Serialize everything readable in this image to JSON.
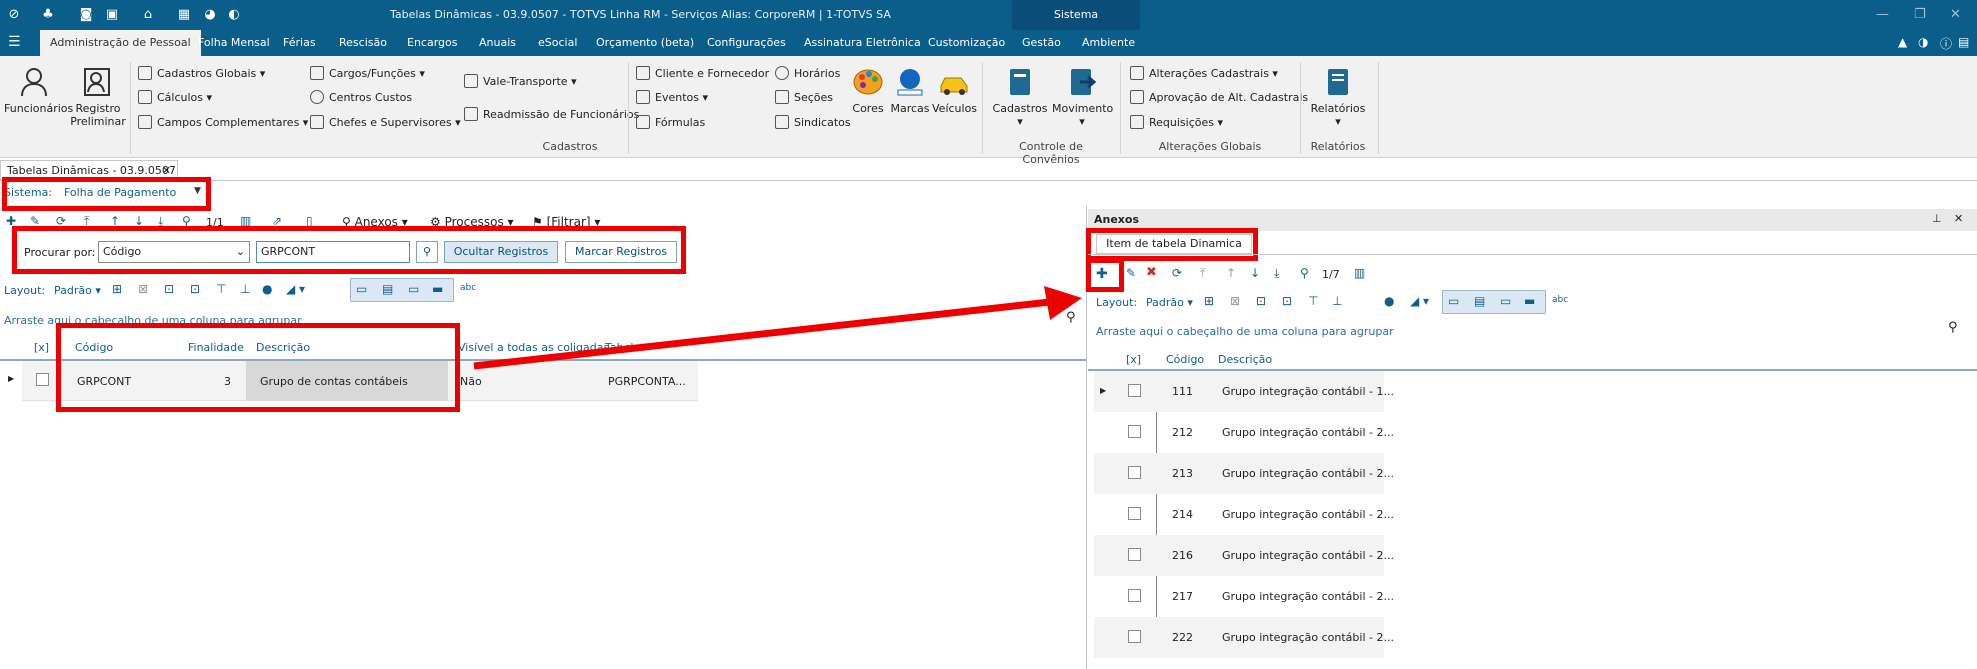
{
  "window": {
    "title": "Tabelas Dinâmicas - 03.9.0507 - TOTVS Linha RM - Serviços  Alias: CorporeRM | 1-TOTVS SA",
    "system": "Sistema"
  },
  "menu": [
    "Administração de Pessoal",
    "Folha Mensal",
    "Férias",
    "Rescisão",
    "Encargos",
    "Anuais",
    "eSocial",
    "Orçamento (beta)",
    "Configurações",
    "Assinatura Eletrônica",
    "Customização",
    "Gestão",
    "Ambiente"
  ],
  "ribbon": {
    "funcionarios": "Funcionários",
    "registro1": "Registro",
    "registro2": "Preliminar",
    "cadastros_globais": "Cadastros Globais",
    "calculos": "Cálculos",
    "campos_complementares": "Campos Complementares",
    "cargos": "Cargos/Funções",
    "centros_custos": "Centros Custos",
    "chefes": "Chefes e Supervisores",
    "vale_transporte": "Vale-Transporte",
    "readmissao": "Readmissão de Funcionários",
    "cliente_fornecedor": "Cliente e Fornecedor",
    "eventos": "Eventos",
    "formulas": "Fórmulas",
    "horarios": "Horários",
    "secoes": "Seções",
    "sindicatos": "Sindicatos",
    "cores": "Cores",
    "marcas": "Marcas",
    "veiculos": "Veículos",
    "cadastros_btn": "Cadastros",
    "movimento": "Movimento",
    "alteracoes_cadastrais": "Alterações Cadastrais",
    "aprovacao": "Aprovação de Alt. Cadastrais",
    "requisicoes": "Requisições",
    "relatorios": "Relatórios",
    "grp_cadastros": "Cadastros",
    "grp_convenios": "Controle de Convênios",
    "grp_alteracoes": "Alterações Globais",
    "grp_relatorios": "Relatórios"
  },
  "doc_tab": "Tabelas Dinâmicas - 03.9.0507",
  "left": {
    "sistema_label": "Sistema:",
    "sistema_value": "Folha de Pagamento",
    "page_counter": "1/1",
    "anexos": "Anexos",
    "processos": "Processos",
    "filtrar": "[Filtrar]",
    "procurar_label": "Procurar por:",
    "procurar_campo": "Código",
    "procurar_valor": "GRPCONT",
    "ocultar": "Ocultar Registros",
    "marcar": "Marcar Registros",
    "layout_label": "Layout:",
    "layout_value": "Padrão",
    "group_hint": "Arraste aqui o cabeçalho de uma coluna para agrupar",
    "columns": [
      "[x]",
      "Código",
      "Finalidade",
      "Descrição",
      "Visível a todas as coligadas",
      "Tabela"
    ],
    "rows": [
      {
        "codigo": "GRPCONT",
        "finalidade": "3",
        "descricao": "Grupo de contas contábeis",
        "visivel": "Não",
        "tabela": "PGRPCONTA..."
      }
    ]
  },
  "right": {
    "title": "Anexos",
    "tab": "Item de tabela Dinamica",
    "page_counter": "1/7",
    "layout_label": "Layout:",
    "layout_value": "Padrão",
    "group_hint": "Arraste aqui o cabeçalho de uma coluna para agrupar",
    "columns": [
      "[x]",
      "Código",
      "Descrição"
    ],
    "rows": [
      {
        "codigo": "111",
        "descricao": "Grupo integração contábil - 1..."
      },
      {
        "codigo": "212",
        "descricao": "Grupo integração contábil - 2..."
      },
      {
        "codigo": "213",
        "descricao": "Grupo integração contábil - 2..."
      },
      {
        "codigo": "214",
        "descricao": "Grupo integração contábil - 2..."
      },
      {
        "codigo": "216",
        "descricao": "Grupo integração contábil - 2..."
      },
      {
        "codigo": "217",
        "descricao": "Grupo integração contábil - 2..."
      },
      {
        "codigo": "222",
        "descricao": "Grupo integração contábil - 2..."
      }
    ]
  },
  "colors": {
    "brand": "#0b5d8a",
    "annotation": "#ef0000",
    "accent": "#0d5f8d"
  }
}
